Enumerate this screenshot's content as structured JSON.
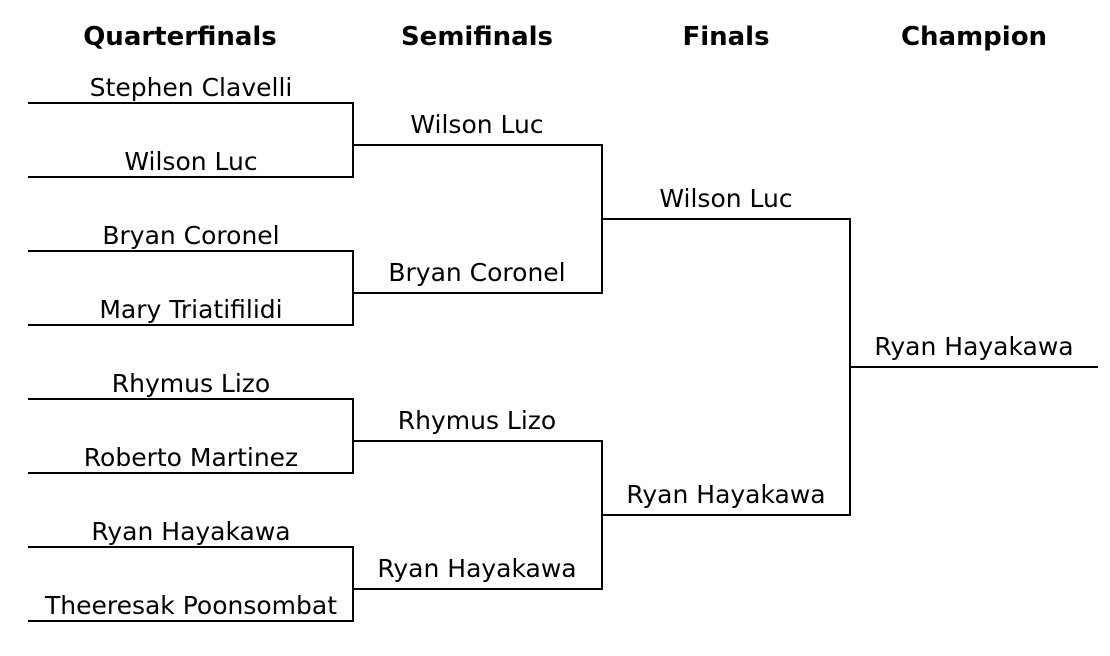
{
  "rounds": {
    "quarterfinals": "Quarterfinals",
    "semifinals": "Semifinals",
    "finals": "Finals",
    "champion": "Champion"
  },
  "quarterfinals": [
    "Stephen Clavelli",
    "Wilson Luc",
    "Bryan Coronel",
    "Mary Triatifilidi",
    "Rhymus Lizo",
    "Roberto Martinez",
    "Ryan Hayakawa",
    "Theeresak Poonsombat"
  ],
  "semifinals": [
    "Wilson Luc",
    "Bryan Coronel",
    "Rhymus Lizo",
    "Ryan Hayakawa"
  ],
  "finals": [
    "Wilson Luc",
    "Ryan Hayakawa"
  ],
  "champion": "Ryan Hayakawa"
}
